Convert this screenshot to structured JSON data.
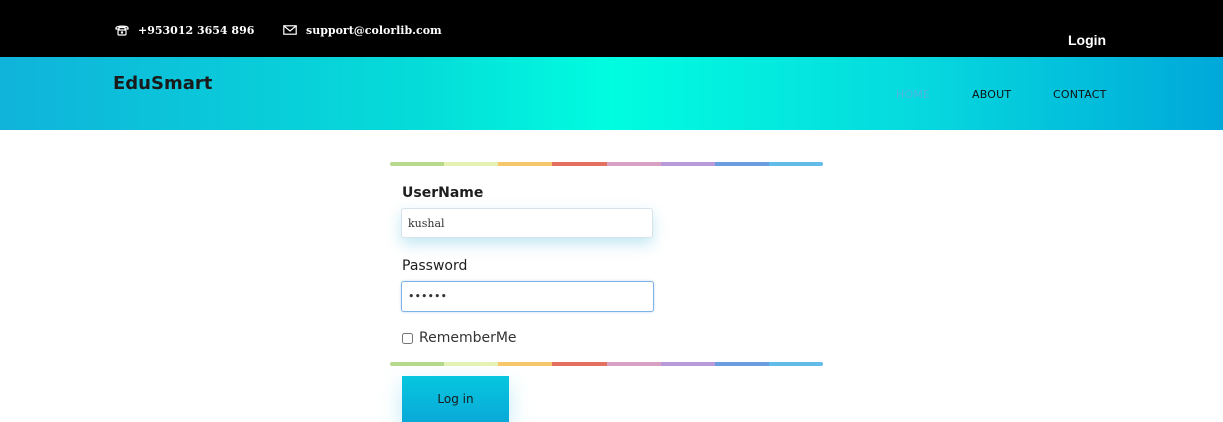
{
  "topbar": {
    "phone": "+953012 3654 896",
    "email": "support@colorlib.com",
    "login_label": "Login",
    "icons": [
      "phone-icon",
      "mail-icon"
    ]
  },
  "navbar": {
    "brand": "EduSmart",
    "items": [
      {
        "label": "HOME",
        "active": true
      },
      {
        "label": "ABOUT",
        "active": false
      },
      {
        "label": "CONTACT",
        "active": false
      }
    ]
  },
  "form": {
    "username_label": "UserName",
    "username_value": "kushal",
    "password_label": "Password",
    "password_value": "••••••",
    "remember_label": "RememberMe",
    "remember_checked": false,
    "submit_label": "Log in"
  },
  "colors": {
    "stripe": [
      "#b6d98a",
      "#e6f2b4",
      "#f7c86a",
      "#e4705f",
      "#d8a0c3",
      "#b99ad9",
      "#6b9ee0",
      "#61bde8"
    ],
    "accent": "#4fb6e2",
    "header_gradient_start": "#10b3da",
    "header_gradient_mid": "#00fde0",
    "header_gradient_end": "#00a8d9"
  }
}
